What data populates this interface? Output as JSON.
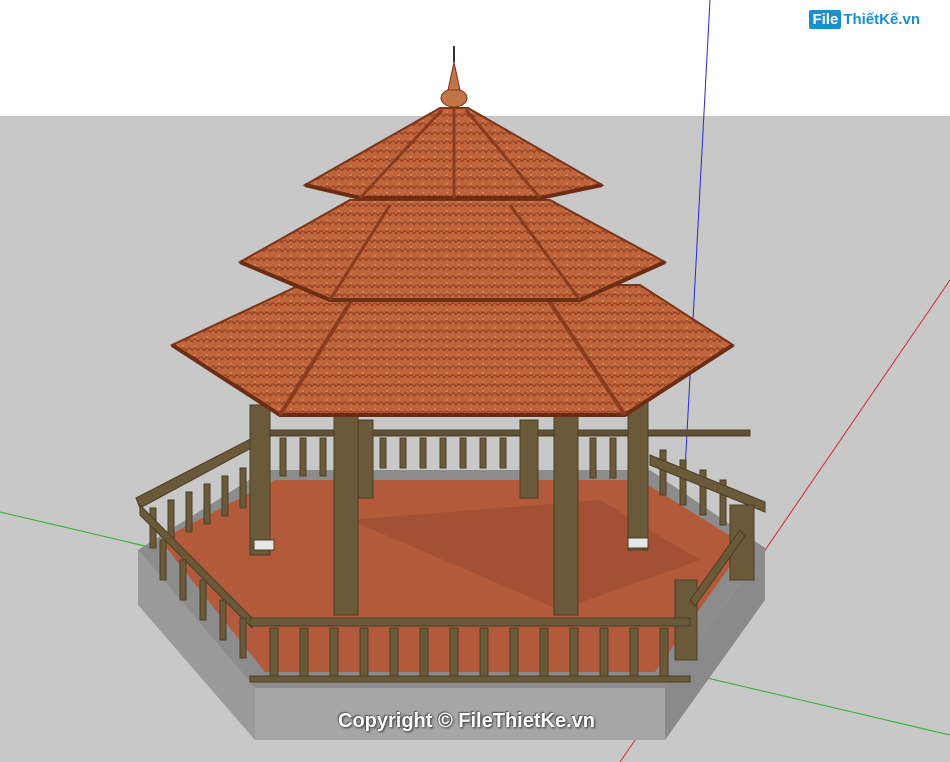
{
  "watermark": {
    "logo_box": "File",
    "logo_text": "ThiếtKế.vn"
  },
  "copyright": "Copyright © FileThietKe.vn",
  "colors": {
    "sky": "#ffffff",
    "ground": "#c8c8c8",
    "roof_tile": "#c0643c",
    "roof_dark": "#8a3c1e",
    "floor": "#b85c3c",
    "wood": "#6b5a3a",
    "base": "#9a9a9a",
    "axis_blue": "#2a2ad0",
    "axis_red": "#d02a2a",
    "axis_green": "#2ab02a"
  },
  "icons": [
    "gazebo-model",
    "axis-lines"
  ]
}
